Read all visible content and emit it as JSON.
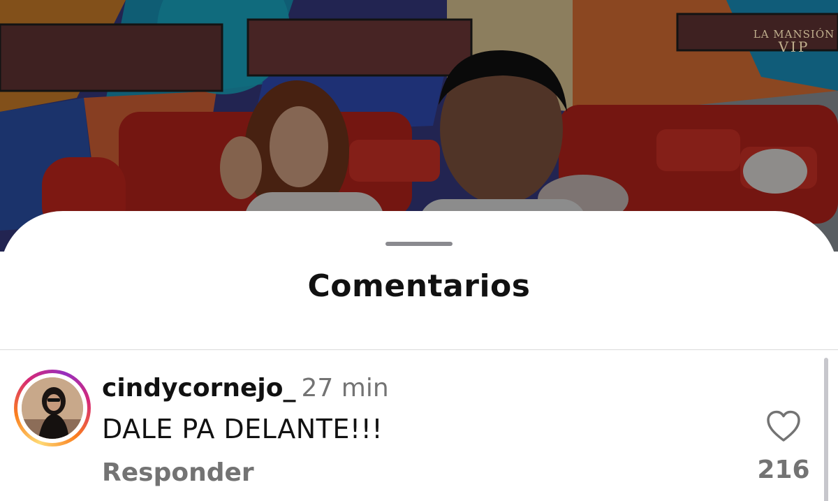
{
  "video": {
    "watermark_line1": "LA MANSIÓN",
    "watermark_line2": "VIP"
  },
  "sheet": {
    "title": "Comentarios"
  },
  "comments": [
    {
      "username": "cindycornejo_",
      "time": "27 min",
      "text": "DALE PA DELANTE!!!",
      "reply_label": "Responder",
      "like_icon": "heart-outline-icon",
      "likes": "216"
    }
  ],
  "colors": {
    "title_text": "#111111",
    "secondary_text": "#737373",
    "divider": "#dbdbdb",
    "story_ring": [
      "#feda75",
      "#fa7e1e",
      "#d62976",
      "#962fbf"
    ]
  }
}
